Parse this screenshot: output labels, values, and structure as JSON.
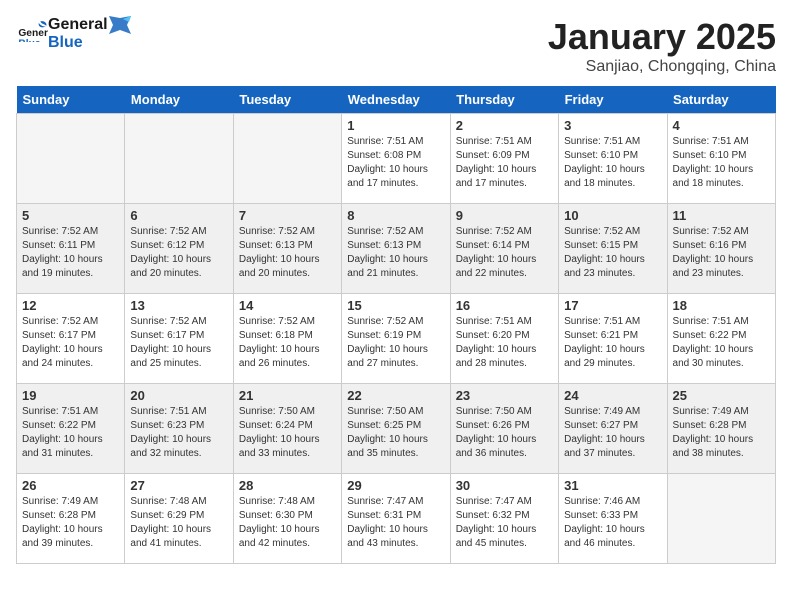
{
  "header": {
    "logo_line1": "General",
    "logo_line2": "Blue",
    "title": "January 2025",
    "subtitle": "Sanjiao, Chongqing, China"
  },
  "weekdays": [
    "Sunday",
    "Monday",
    "Tuesday",
    "Wednesday",
    "Thursday",
    "Friday",
    "Saturday"
  ],
  "weeks": [
    [
      {
        "day": "",
        "empty": true
      },
      {
        "day": "",
        "empty": true
      },
      {
        "day": "",
        "empty": true
      },
      {
        "day": "1",
        "sunrise": "7:51 AM",
        "sunset": "6:08 PM",
        "daylight": "10 hours and 17 minutes."
      },
      {
        "day": "2",
        "sunrise": "7:51 AM",
        "sunset": "6:09 PM",
        "daylight": "10 hours and 17 minutes."
      },
      {
        "day": "3",
        "sunrise": "7:51 AM",
        "sunset": "6:10 PM",
        "daylight": "10 hours and 18 minutes."
      },
      {
        "day": "4",
        "sunrise": "7:51 AM",
        "sunset": "6:10 PM",
        "daylight": "10 hours and 18 minutes."
      }
    ],
    [
      {
        "day": "5",
        "sunrise": "7:52 AM",
        "sunset": "6:11 PM",
        "daylight": "10 hours and 19 minutes."
      },
      {
        "day": "6",
        "sunrise": "7:52 AM",
        "sunset": "6:12 PM",
        "daylight": "10 hours and 20 minutes."
      },
      {
        "day": "7",
        "sunrise": "7:52 AM",
        "sunset": "6:13 PM",
        "daylight": "10 hours and 20 minutes."
      },
      {
        "day": "8",
        "sunrise": "7:52 AM",
        "sunset": "6:13 PM",
        "daylight": "10 hours and 21 minutes."
      },
      {
        "day": "9",
        "sunrise": "7:52 AM",
        "sunset": "6:14 PM",
        "daylight": "10 hours and 22 minutes."
      },
      {
        "day": "10",
        "sunrise": "7:52 AM",
        "sunset": "6:15 PM",
        "daylight": "10 hours and 23 minutes."
      },
      {
        "day": "11",
        "sunrise": "7:52 AM",
        "sunset": "6:16 PM",
        "daylight": "10 hours and 23 minutes."
      }
    ],
    [
      {
        "day": "12",
        "sunrise": "7:52 AM",
        "sunset": "6:17 PM",
        "daylight": "10 hours and 24 minutes."
      },
      {
        "day": "13",
        "sunrise": "7:52 AM",
        "sunset": "6:17 PM",
        "daylight": "10 hours and 25 minutes."
      },
      {
        "day": "14",
        "sunrise": "7:52 AM",
        "sunset": "6:18 PM",
        "daylight": "10 hours and 26 minutes."
      },
      {
        "day": "15",
        "sunrise": "7:52 AM",
        "sunset": "6:19 PM",
        "daylight": "10 hours and 27 minutes."
      },
      {
        "day": "16",
        "sunrise": "7:51 AM",
        "sunset": "6:20 PM",
        "daylight": "10 hours and 28 minutes."
      },
      {
        "day": "17",
        "sunrise": "7:51 AM",
        "sunset": "6:21 PM",
        "daylight": "10 hours and 29 minutes."
      },
      {
        "day": "18",
        "sunrise": "7:51 AM",
        "sunset": "6:22 PM",
        "daylight": "10 hours and 30 minutes."
      }
    ],
    [
      {
        "day": "19",
        "sunrise": "7:51 AM",
        "sunset": "6:22 PM",
        "daylight": "10 hours and 31 minutes."
      },
      {
        "day": "20",
        "sunrise": "7:51 AM",
        "sunset": "6:23 PM",
        "daylight": "10 hours and 32 minutes."
      },
      {
        "day": "21",
        "sunrise": "7:50 AM",
        "sunset": "6:24 PM",
        "daylight": "10 hours and 33 minutes."
      },
      {
        "day": "22",
        "sunrise": "7:50 AM",
        "sunset": "6:25 PM",
        "daylight": "10 hours and 35 minutes."
      },
      {
        "day": "23",
        "sunrise": "7:50 AM",
        "sunset": "6:26 PM",
        "daylight": "10 hours and 36 minutes."
      },
      {
        "day": "24",
        "sunrise": "7:49 AM",
        "sunset": "6:27 PM",
        "daylight": "10 hours and 37 minutes."
      },
      {
        "day": "25",
        "sunrise": "7:49 AM",
        "sunset": "6:28 PM",
        "daylight": "10 hours and 38 minutes."
      }
    ],
    [
      {
        "day": "26",
        "sunrise": "7:49 AM",
        "sunset": "6:28 PM",
        "daylight": "10 hours and 39 minutes."
      },
      {
        "day": "27",
        "sunrise": "7:48 AM",
        "sunset": "6:29 PM",
        "daylight": "10 hours and 41 minutes."
      },
      {
        "day": "28",
        "sunrise": "7:48 AM",
        "sunset": "6:30 PM",
        "daylight": "10 hours and 42 minutes."
      },
      {
        "day": "29",
        "sunrise": "7:47 AM",
        "sunset": "6:31 PM",
        "daylight": "10 hours and 43 minutes."
      },
      {
        "day": "30",
        "sunrise": "7:47 AM",
        "sunset": "6:32 PM",
        "daylight": "10 hours and 45 minutes."
      },
      {
        "day": "31",
        "sunrise": "7:46 AM",
        "sunset": "6:33 PM",
        "daylight": "10 hours and 46 minutes."
      },
      {
        "day": "",
        "empty": true
      }
    ]
  ],
  "labels": {
    "sunrise_prefix": "Sunrise: ",
    "sunset_prefix": "Sunset: ",
    "daylight_label": "Daylight: "
  }
}
